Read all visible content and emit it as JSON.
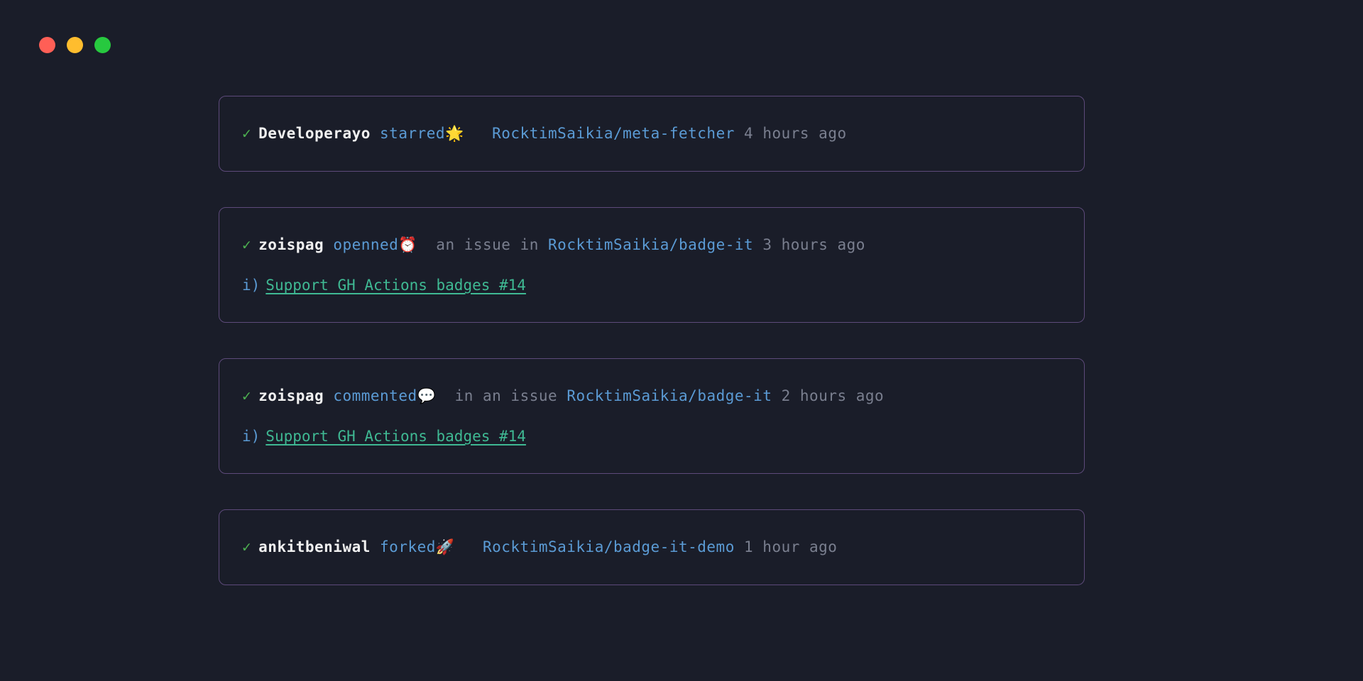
{
  "feed": [
    {
      "check": "✓",
      "actor": "Developerayo",
      "verb": "starred",
      "emoji": "🌟",
      "extra": "",
      "repo": "RocktimSaikia/meta-fetcher",
      "time": "4 hours ago",
      "detail": null
    },
    {
      "check": "✓",
      "actor": "zoispag",
      "verb": "openned",
      "emoji": "⏰",
      "extra": "an issue in",
      "repo": "RocktimSaikia/badge-it",
      "time": "3 hours ago",
      "detail": {
        "marker": "i)",
        "title": "Support GH Actions badges #14"
      }
    },
    {
      "check": "✓",
      "actor": "zoispag",
      "verb": "commented",
      "emoji": "💬",
      "extra": "in an issue",
      "repo": "RocktimSaikia/badge-it",
      "time": "2 hours ago",
      "detail": {
        "marker": "i)",
        "title": "Support GH Actions badges #14"
      }
    },
    {
      "check": "✓",
      "actor": "ankitbeniwal",
      "verb": "forked",
      "emoji": "🚀",
      "extra": "",
      "repo": "RocktimSaikia/badge-it-demo",
      "time": "1 hour ago",
      "detail": null
    }
  ]
}
